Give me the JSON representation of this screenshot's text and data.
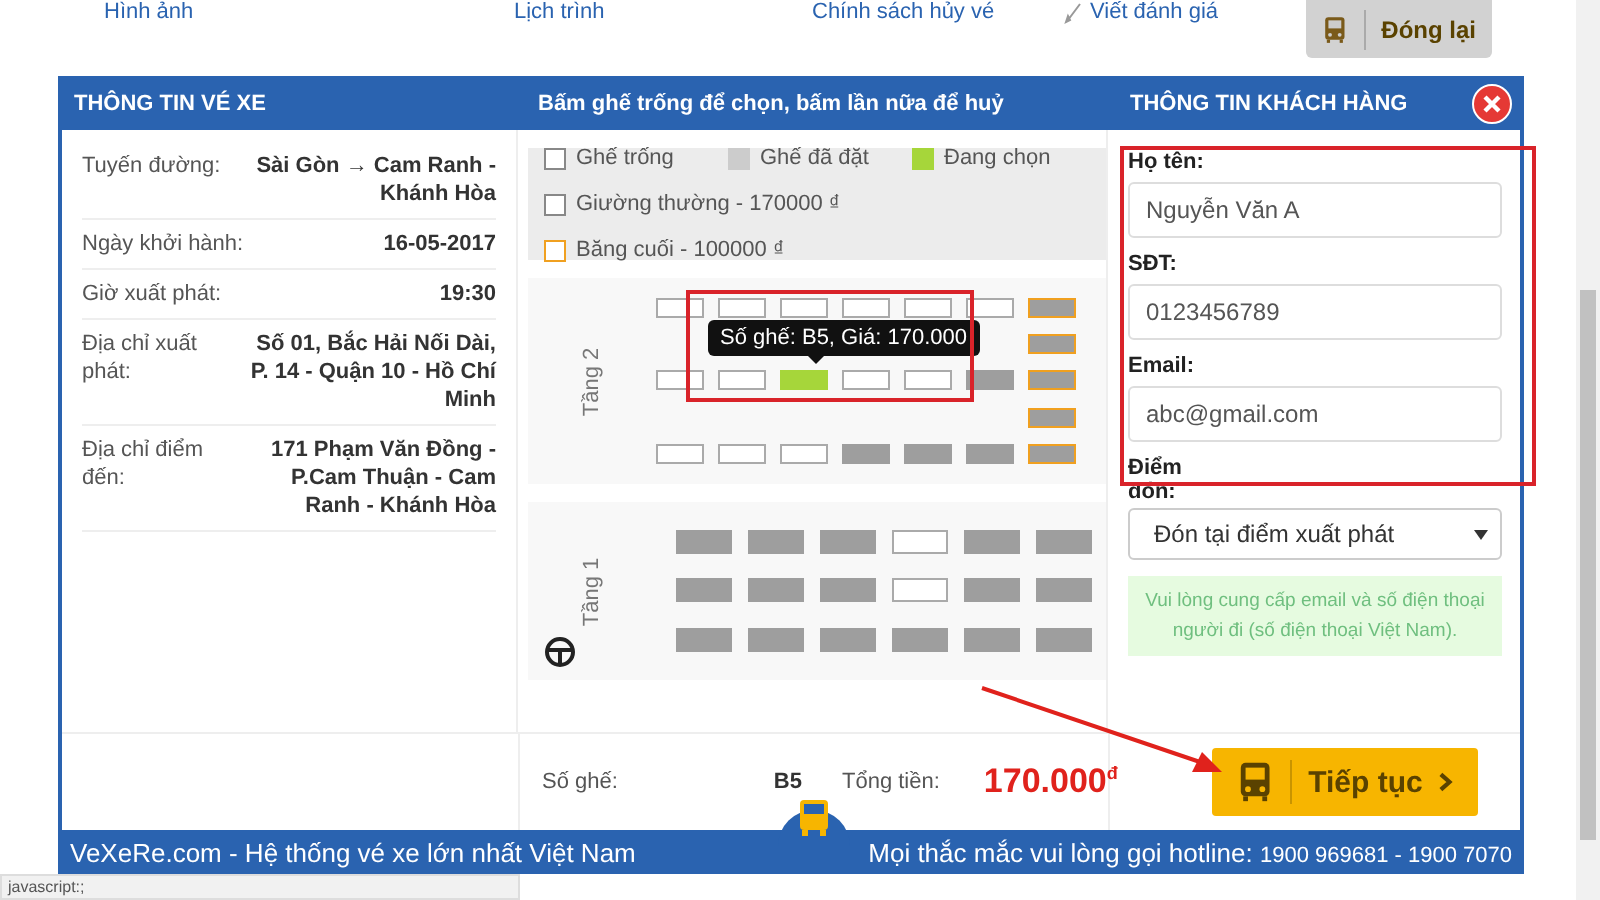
{
  "top_links": [
    {
      "label": "Hình ảnh",
      "icon": false
    },
    {
      "label": "Lịch trình",
      "icon": false
    },
    {
      "label": "Chính sách hủy vé",
      "icon": false
    },
    {
      "label": "Viết đánh giá",
      "icon": true
    }
  ],
  "close_button": "Đóng lại",
  "header": {
    "trip": "THÔNG TIN VÉ XE",
    "seats": "Bấm ghế trống để chọn, bấm lần nữa để huỷ",
    "customer": "THÔNG TIN KHÁCH HÀNG"
  },
  "trip_info": [
    {
      "label": "Tuyến đường:",
      "value": "Sài Gòn → Cam Ranh - Khánh Hòa"
    },
    {
      "label": "Ngày khởi hành:",
      "value": "16-05-2017"
    },
    {
      "label": "Giờ xuất phát:",
      "value": "19:30"
    },
    {
      "label": "Địa chỉ xuất phát:",
      "value": "Số 01, Bắc Hải Nối Dài, P. 14 - Quận 10 - Hồ Chí Minh"
    },
    {
      "label": "Địa chỉ điểm đến:",
      "value": "171 Phạm Văn Đồng - P.Cam Thuận - Cam Ranh - Khánh Hòa"
    }
  ],
  "legend": [
    {
      "label": "Ghế trống",
      "kind": "empty"
    },
    {
      "label": "Ghế đã đặt",
      "kind": "booked"
    },
    {
      "label": "Đang chọn",
      "kind": "selected"
    },
    {
      "label": "Giường thường - 170000 ₫",
      "kind": "empty"
    },
    {
      "label": "Băng cuối - 100000 ₫",
      "kind": "bench"
    }
  ],
  "decks": [
    {
      "name": "Tầng 2",
      "steering_wheel": false,
      "rows": [
        [
          {
            "kind": "empty"
          },
          {
            "kind": "empty"
          },
          {
            "kind": "empty"
          },
          {
            "kind": "empty"
          },
          {
            "kind": "empty"
          },
          {
            "kind": "empty"
          },
          {
            "kind": "bench"
          }
        ],
        [
          null,
          null,
          null,
          null,
          null,
          null,
          {
            "kind": "bench"
          }
        ],
        [
          {
            "kind": "empty"
          },
          {
            "kind": "empty"
          },
          {
            "kind": "selected"
          },
          {
            "kind": "empty"
          },
          {
            "kind": "empty"
          },
          {
            "kind": "booked"
          },
          {
            "kind": "bench"
          }
        ],
        [
          null,
          null,
          null,
          null,
          null,
          null,
          {
            "kind": "bench"
          }
        ],
        [
          {
            "kind": "empty"
          },
          {
            "kind": "empty"
          },
          {
            "kind": "empty"
          },
          {
            "kind": "booked"
          },
          {
            "kind": "booked"
          },
          {
            "kind": "booked"
          },
          {
            "kind": "bench"
          }
        ]
      ]
    },
    {
      "name": "Tầng 1",
      "steering_wheel": true,
      "rows": [
        [
          {
            "kind": "booked"
          },
          {
            "kind": "booked"
          },
          {
            "kind": "booked"
          },
          {
            "kind": "empty"
          },
          {
            "kind": "booked"
          },
          {
            "kind": "booked"
          }
        ],
        [
          {
            "kind": "booked"
          },
          {
            "kind": "booked"
          },
          {
            "kind": "booked"
          },
          {
            "kind": "empty"
          },
          {
            "kind": "booked"
          },
          {
            "kind": "booked"
          }
        ],
        [
          {
            "kind": "booked"
          },
          {
            "kind": "booked"
          },
          {
            "kind": "booked"
          },
          {
            "kind": "booked"
          },
          {
            "kind": "booked"
          },
          {
            "kind": "booked"
          }
        ]
      ]
    }
  ],
  "tooltip": "Số ghế: B5, Giá: 170.000",
  "customer_fields": [
    {
      "label": "Họ tên:",
      "value": "Nguyễn Văn A"
    },
    {
      "label": "SĐT:",
      "value": "0123456789"
    },
    {
      "label": "Email:",
      "value": "abc@gmail.com"
    }
  ],
  "pickup": {
    "label": "Điểm đón:",
    "value": "Đón tại điểm xuất phát"
  },
  "note": "Vui lòng cung cấp email và số điện thoại người đi (số điện thoại Việt Nam).",
  "summary": {
    "seat_label": "Số ghế:",
    "seat": "B5",
    "total_label": "Tổng tiền:",
    "total": "170.000",
    "currency": "đ"
  },
  "continue_button": "Tiếp tục",
  "footer": {
    "brand": "VeXeRe.com - Hệ thống vé xe lớn nhất Việt Nam",
    "hotline_label": "Mọi thắc mắc vui lòng gọi hotline:",
    "hotline": "1900 969681 - 1900 7070"
  },
  "status_bar": "javascript:;"
}
